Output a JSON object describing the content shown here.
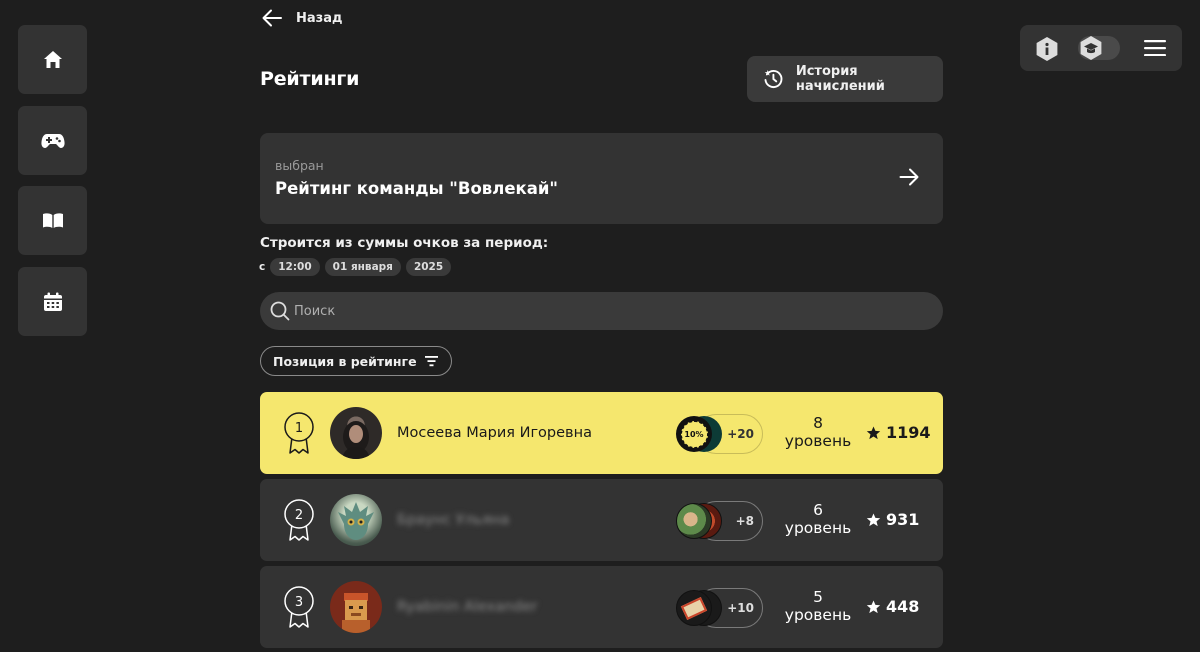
{
  "nav": {
    "back_label": "Назад",
    "sidebar": [
      {
        "icon": "home-icon"
      },
      {
        "icon": "gamepad-icon"
      },
      {
        "icon": "book-icon"
      },
      {
        "icon": "calendar-icon"
      }
    ]
  },
  "header": {
    "title": "Рейтинги",
    "history_button": "История начислений"
  },
  "selected_rating": {
    "caption": "выбран",
    "value": "Рейтинг команды \"Вовлекай\""
  },
  "period": {
    "title": "Строится из суммы очков за период:",
    "prefix": "с",
    "time": "12:00",
    "date": "01 января",
    "year": "2025"
  },
  "search": {
    "placeholder": "Поиск"
  },
  "sort": {
    "label": "Позиция в рейтинге"
  },
  "leaderboard": [
    {
      "position": "1",
      "name": "Мосеева Мария Игоревна",
      "badge_text": "10%",
      "badges_more": "+20",
      "level_number": "8",
      "level_word": "уровень",
      "score": "1194"
    },
    {
      "position": "2",
      "name": "Браунс Ульяна",
      "badges_more": "+8",
      "level_number": "6",
      "level_word": "уровень",
      "score": "931"
    },
    {
      "position": "3",
      "name": "Ryabinin Alexander",
      "badges_more": "+10",
      "level_number": "5",
      "level_word": "уровень",
      "score": "448"
    }
  ],
  "colors": {
    "highlight": "#f5e76e",
    "panel": "#333333",
    "background": "#1e1e1e"
  }
}
